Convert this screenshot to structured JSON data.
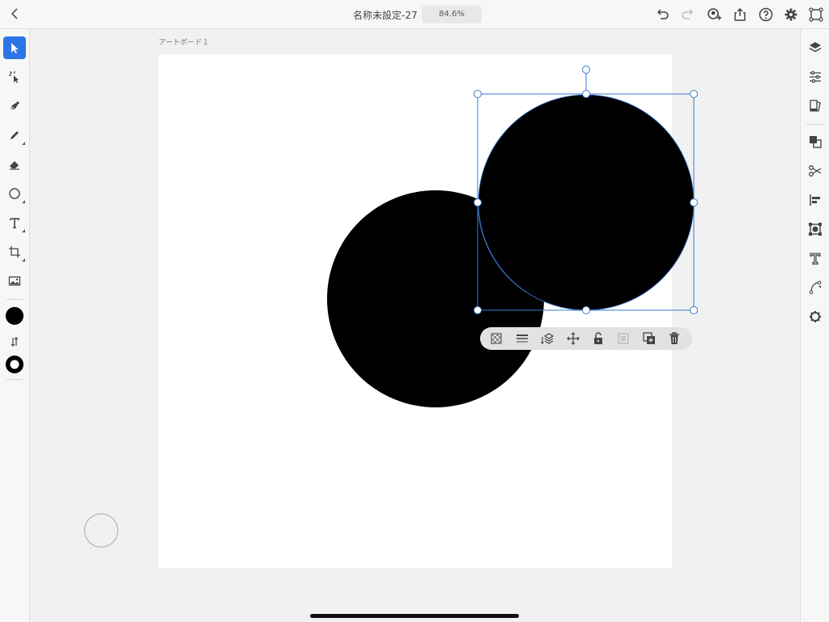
{
  "header": {
    "title": "名称未設定-27",
    "zoom": "84.6%"
  },
  "canvas": {
    "artboard_label": "アートボード１"
  },
  "icons": {
    "back": "chevron-left-icon",
    "undo": "undo-icon",
    "redo": "redo-icon",
    "invite": "add-person-icon",
    "share": "share-icon",
    "help": "help-icon",
    "settings": "gear-icon",
    "prototype": "frame-icon"
  },
  "colors": {
    "accent": "#2d75e6",
    "selection": "#3a7ad0",
    "fill": "#000000"
  }
}
